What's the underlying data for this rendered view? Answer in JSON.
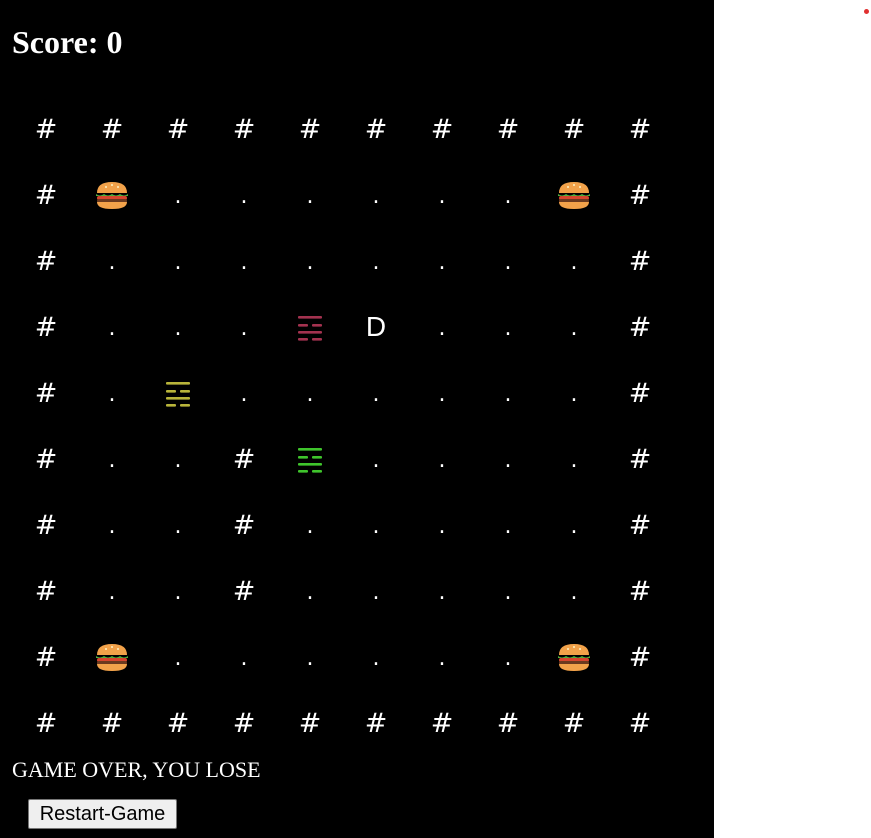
{
  "score": {
    "text": "Score: 0"
  },
  "board": {
    "rows": [
      "##########",
      "#B......B#",
      "#........#",
      "#...RP...#",
      "#.Y......#",
      "#..#G....#",
      "#..#.....#",
      "#..#.....#",
      "#B......B#",
      "##########"
    ],
    "legend": {
      "#": {
        "name": "wall",
        "glyph": "#"
      },
      ".": {
        "name": "pellet",
        "glyph": "."
      },
      "B": {
        "name": "burger-power-pellet",
        "glyph": "burger-icon"
      },
      "P": {
        "name": "player-pacman",
        "glyph": "D"
      },
      "R": {
        "name": "ghost",
        "glyph": "ghost-icon",
        "color": "#a3324f"
      },
      "Y": {
        "name": "ghost",
        "glyph": "ghost-icon",
        "color": "#b8b43a"
      },
      "G": {
        "name": "ghost",
        "glyph": "ghost-icon",
        "color": "#3fc42c"
      }
    }
  },
  "status": {
    "message": "GAME OVER, YOU LOSE"
  },
  "restart": {
    "label": "Restart-Game"
  },
  "colors": {
    "board_background": "#000000",
    "page_background": "#ffffff",
    "text": "#ffffff",
    "recording_dot": "#e03030"
  }
}
